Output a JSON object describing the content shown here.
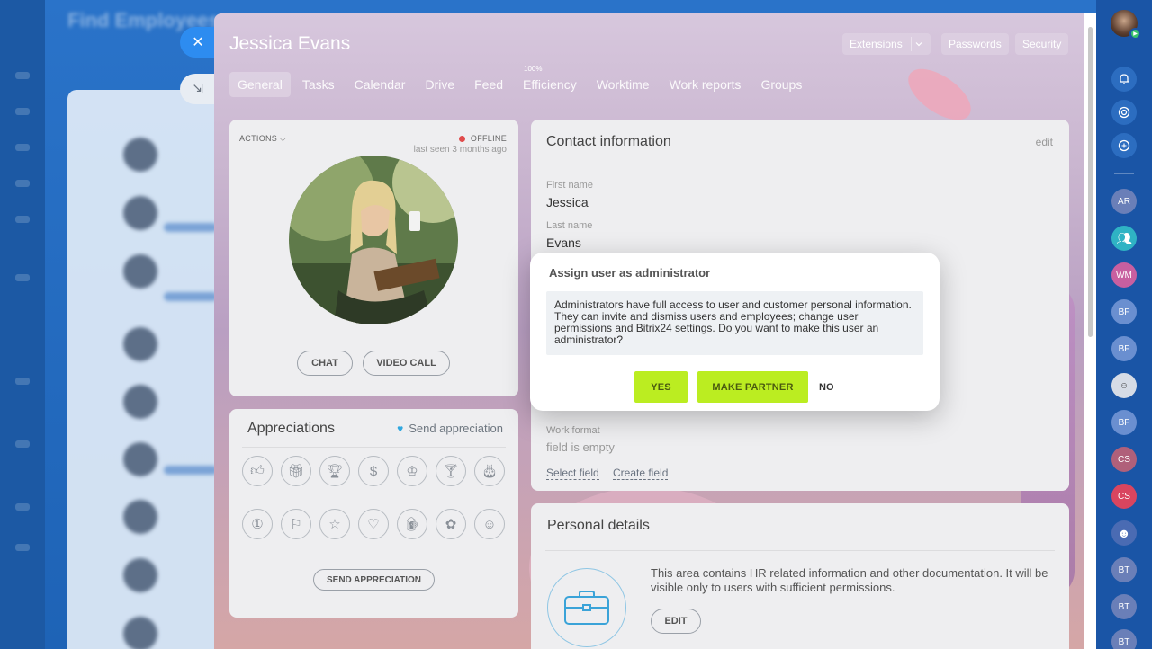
{
  "background": {
    "title": "Find Employees"
  },
  "side_buttons": {
    "close": "✕",
    "minimize": "⇲"
  },
  "header": {
    "title": "Jessica Evans",
    "buttons": {
      "extensions": "Extensions",
      "passwords": "Passwords",
      "security": "Security"
    }
  },
  "tabs": [
    {
      "label": "General",
      "active": true
    },
    {
      "label": "Tasks"
    },
    {
      "label": "Calendar"
    },
    {
      "label": "Drive"
    },
    {
      "label": "Feed"
    },
    {
      "label": "Efficiency",
      "badge": "100%"
    },
    {
      "label": "Worktime"
    },
    {
      "label": "Work reports"
    },
    {
      "label": "Groups"
    }
  ],
  "profile": {
    "actions_label": "ACTIONS",
    "status": "OFFLINE",
    "last_seen": "last seen 3 months ago",
    "chat_label": "CHAT",
    "video_call_label": "VIDEO CALL"
  },
  "appreciations": {
    "title": "Appreciations",
    "send_link": "Send appreciation",
    "send_button": "SEND APPRECIATION",
    "icons": [
      "thumbs-up-icon",
      "gift-icon",
      "trophy-icon",
      "money-bag-icon",
      "crown-icon",
      "cocktail-icon",
      "cake-icon",
      "number-one-icon",
      "flag-icon",
      "star-icon",
      "heart-icon",
      "beer-icon",
      "flower-icon",
      "smile-icon"
    ]
  },
  "contact": {
    "title": "Contact information",
    "edit": "edit",
    "first_name_label": "First name",
    "first_name": "Jessica",
    "last_name_label": "Last name",
    "last_name": "Evans",
    "work_format_label": "Work format",
    "work_format_value": "field is empty",
    "select_field": "Select field",
    "create_field": "Create field"
  },
  "personal": {
    "title": "Personal details",
    "description": "This area contains HR related information and other documentation. It will be visible only to users with sufficient permissions.",
    "edit_label": "EDIT"
  },
  "dialog": {
    "title": "Assign user as administrator",
    "message": "Administrators have full access to user and customer personal information. They can invite and dismiss users and employees; change user permissions and Bitrix24 settings. Do you want to make this user an administrator?",
    "yes": "YES",
    "make_partner": "MAKE PARTNER",
    "no": "NO"
  },
  "right_bar": {
    "initials": [
      "AR",
      "WM",
      "BF",
      "BF",
      "BF",
      "CS",
      "CS",
      "BT",
      "BT",
      "BT"
    ]
  },
  "colors": {
    "accent_green": "#bbed21",
    "offline_red": "#e04b4b",
    "brand_blue": "#2d8cf0"
  }
}
